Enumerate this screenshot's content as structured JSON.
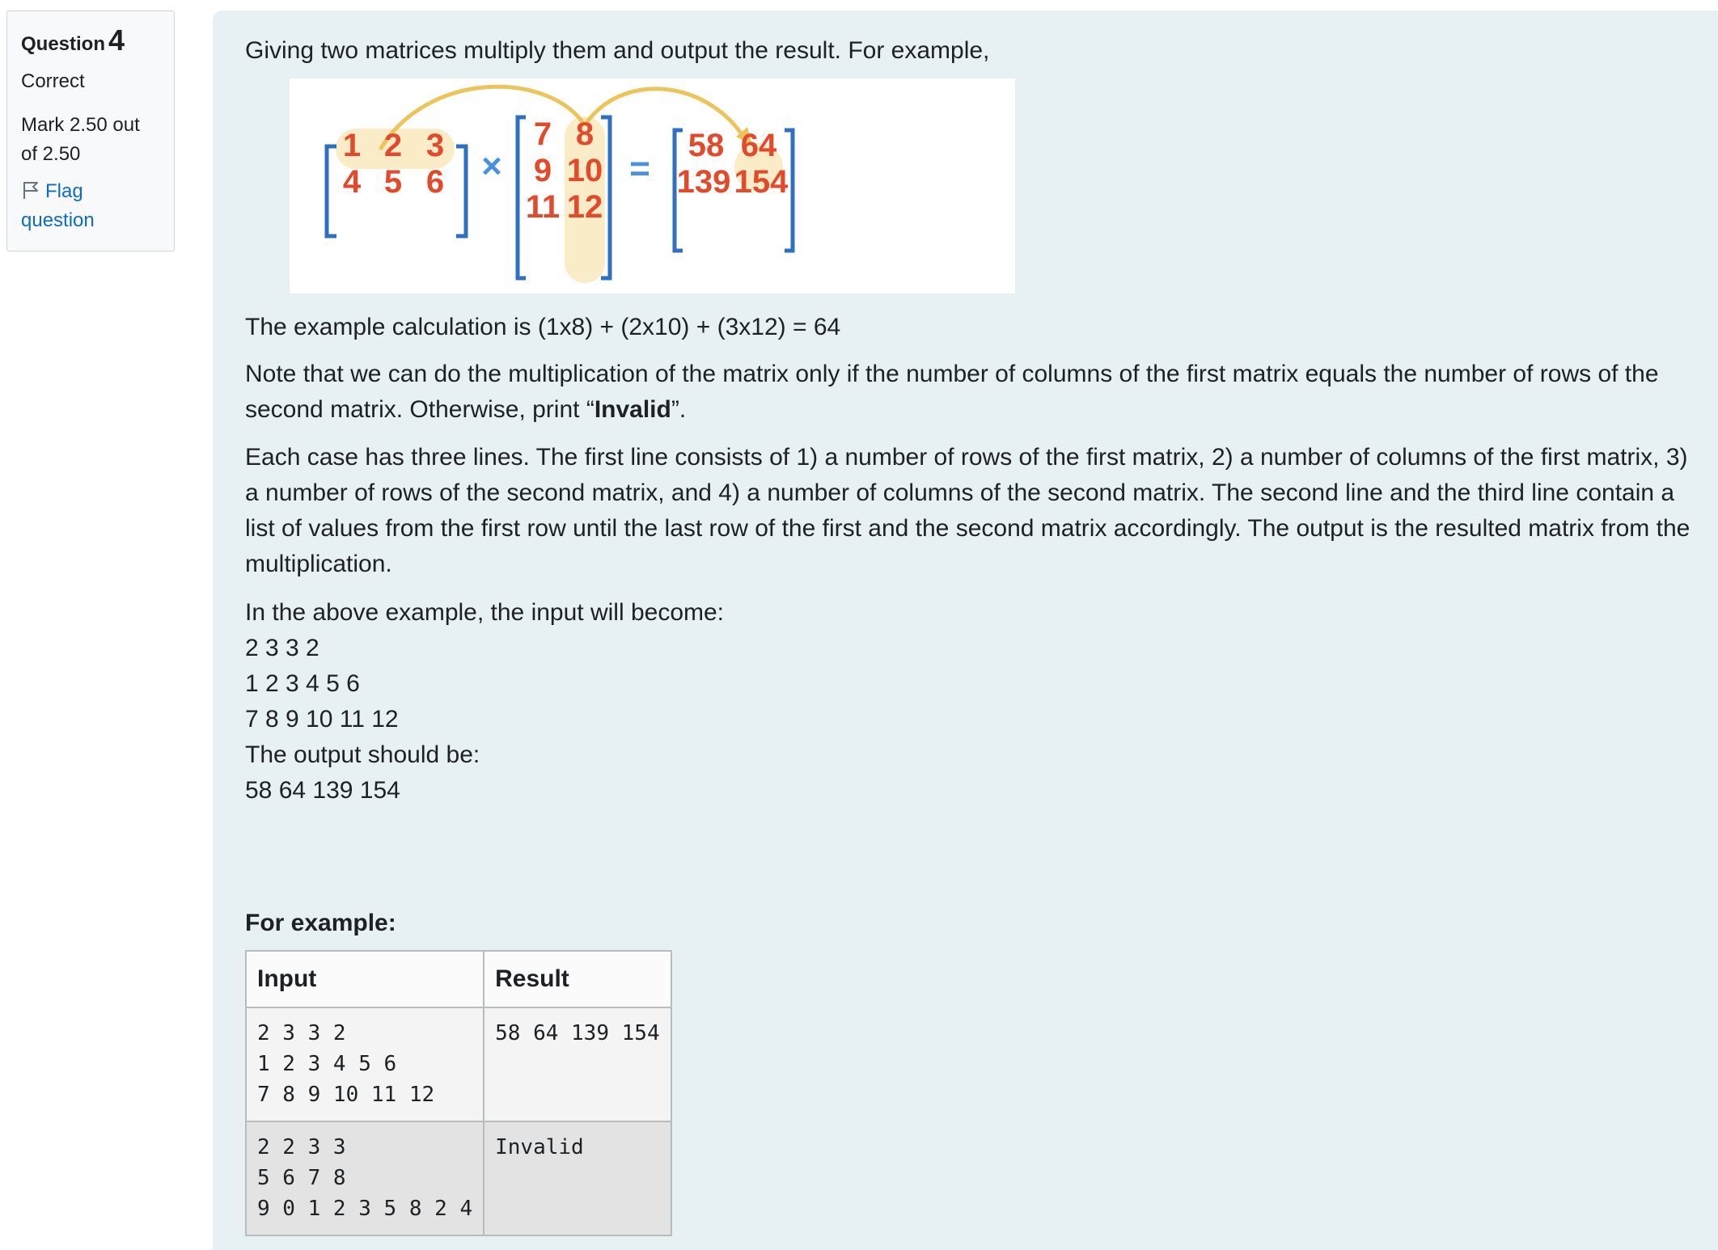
{
  "info": {
    "question_label": "Question",
    "question_number": "4",
    "state": "Correct",
    "grade": "Mark 2.50 out of 2.50",
    "flag_label": "Flag question",
    "flag_icon": "flag-outline-icon"
  },
  "question": {
    "intro": "Giving two matrices multiply them and output the result. For example,",
    "figure": {
      "matrix_a": [
        [
          "1",
          "2",
          "3"
        ],
        [
          "4",
          "5",
          "6"
        ]
      ],
      "times_symbol": "×",
      "matrix_b": [
        [
          "7",
          "8"
        ],
        [
          "9",
          "10"
        ],
        [
          "11",
          "12"
        ]
      ],
      "equals_symbol": "=",
      "matrix_c": [
        [
          "58",
          "64"
        ],
        [
          "139",
          "154"
        ]
      ],
      "colors": {
        "number": "#e24a2b",
        "bracket": "#2f6fc4",
        "operator": "#4a90e2",
        "highlight": "#fbecc8",
        "arrow": "#ecc45a"
      }
    },
    "calc": "The example calculation is (1x8) + (2x10) + (3x12) = 64",
    "note_before": "Note that we can do the multiplication of the matrix only if the number of columns of the first matrix equals the number of rows of the second matrix. Otherwise, print “",
    "note_bold": "Invalid",
    "note_after": "”.",
    "case_description": "Each case has three lines. The first line consists of 1) a number of rows of the first matrix, 2) a number of columns of the first matrix, 3) a number of rows of the second matrix, and 4) a number of columns of the second matrix. The second line and the third line contain a list of values from the first row until the last row of the first and the second matrix accordingly. The output is the resulted matrix from the multiplication.",
    "above_example_intro": "In the above example, the input will become:",
    "input_lines": [
      "2 3 3 2",
      "1 2 3 4 5 6",
      "7 8 9 10 11 12"
    ],
    "output_intro": "The output should be:",
    "output_line": "58 64 139 154"
  },
  "examples": {
    "label": "For example:",
    "headers": {
      "input": "Input",
      "result": "Result"
    },
    "rows": [
      {
        "input": "2 3 3 2\n1 2 3 4 5 6\n7 8 9 10 11 12",
        "result": "58 64 139 154"
      },
      {
        "input": "2 2 3 3\n5 6 7 8\n9 0 1 2 3 5 8 2 4",
        "result": "Invalid"
      }
    ]
  }
}
